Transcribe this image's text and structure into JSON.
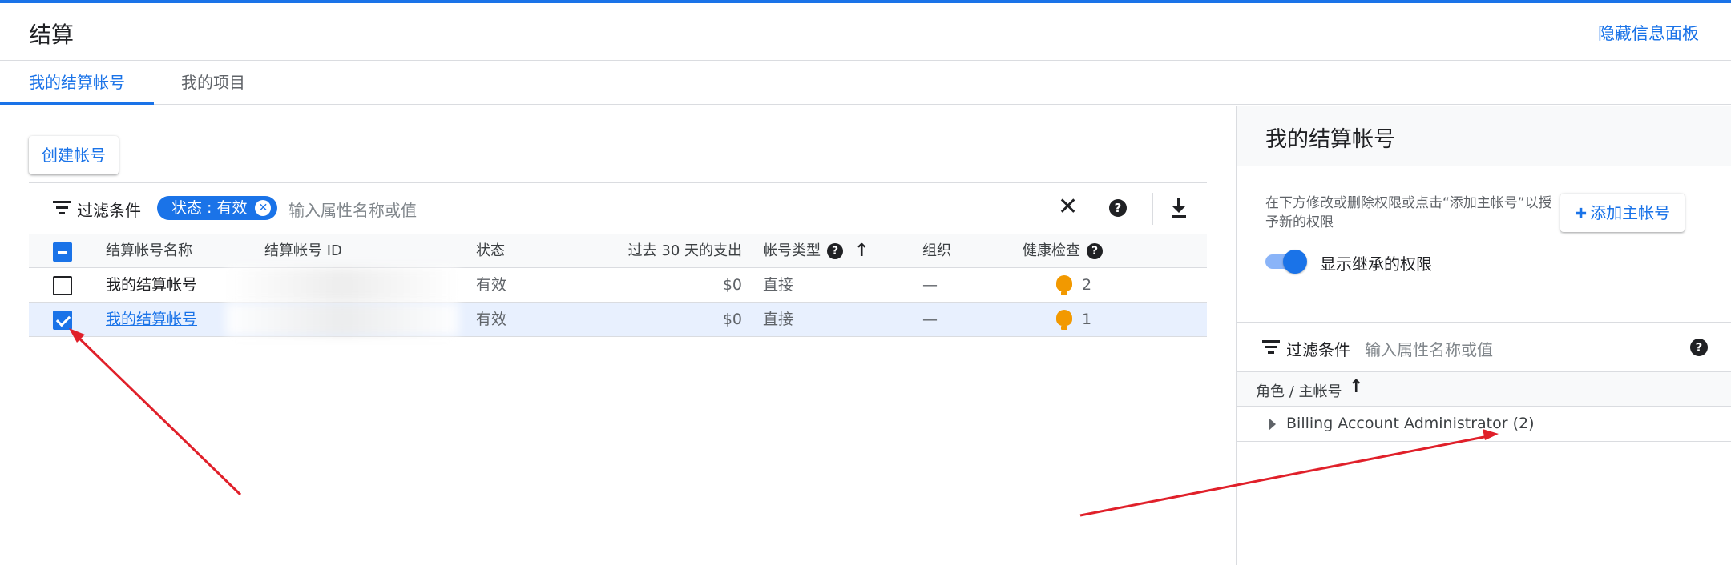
{
  "header": {
    "title": "结算",
    "hide_panel": "隐藏信息面板"
  },
  "tabs": [
    {
      "label": "我的结算帐号",
      "active": true
    },
    {
      "label": "我的项目",
      "active": false
    }
  ],
  "main": {
    "create_button": "创建帐号",
    "filter": {
      "label": "过滤条件",
      "chip": "状态 : 有效",
      "placeholder": "输入属性名称或值"
    },
    "table": {
      "headers": [
        "结算帐号名称",
        "结算帐号 ID",
        "状态",
        "过去 30 天的支出",
        "帐号类型",
        "组织",
        "健康检查"
      ],
      "rows": [
        {
          "name": "我的结算帐号",
          "status": "有效",
          "spend": "$0",
          "type": "直接",
          "org": "—",
          "health": "2",
          "checked": false
        },
        {
          "name": "我的结算帐号",
          "status": "有效",
          "spend": "$0",
          "type": "直接",
          "org": "—",
          "health": "1",
          "checked": true
        }
      ]
    }
  },
  "panel": {
    "title": "我的结算帐号",
    "description": "在下方修改或删除权限或点击“添加主帐号”以授予新的权限",
    "add_button": "添加主帐号",
    "toggle_label": "显示继承的权限",
    "filter_label": "过滤条件",
    "filter_placeholder": "输入属性名称或值",
    "column_header": "角色 / 主帐号",
    "role_row": "Billing Account Administrator (2)"
  },
  "colors": {
    "accent": "#1a73e8",
    "annotation": "#e0202a",
    "warning": "#f29900"
  }
}
